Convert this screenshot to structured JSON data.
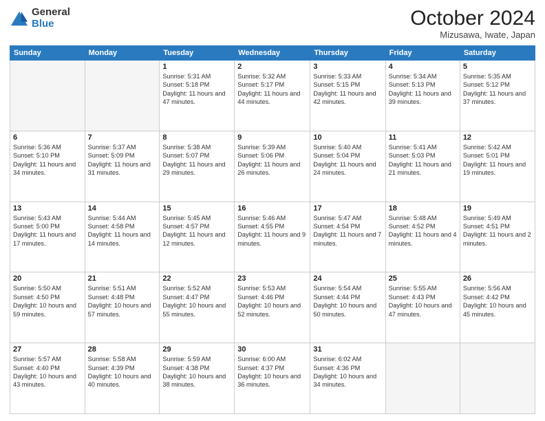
{
  "logo": {
    "general": "General",
    "blue": "Blue"
  },
  "header": {
    "month": "October 2024",
    "location": "Mizusawa, Iwate, Japan"
  },
  "days_of_week": [
    "Sunday",
    "Monday",
    "Tuesday",
    "Wednesday",
    "Thursday",
    "Friday",
    "Saturday"
  ],
  "weeks": [
    [
      {
        "day": "",
        "info": ""
      },
      {
        "day": "",
        "info": ""
      },
      {
        "day": "1",
        "info": "Sunrise: 5:31 AM\nSunset: 5:18 PM\nDaylight: 11 hours and 47 minutes."
      },
      {
        "day": "2",
        "info": "Sunrise: 5:32 AM\nSunset: 5:17 PM\nDaylight: 11 hours and 44 minutes."
      },
      {
        "day": "3",
        "info": "Sunrise: 5:33 AM\nSunset: 5:15 PM\nDaylight: 11 hours and 42 minutes."
      },
      {
        "day": "4",
        "info": "Sunrise: 5:34 AM\nSunset: 5:13 PM\nDaylight: 11 hours and 39 minutes."
      },
      {
        "day": "5",
        "info": "Sunrise: 5:35 AM\nSunset: 5:12 PM\nDaylight: 11 hours and 37 minutes."
      }
    ],
    [
      {
        "day": "6",
        "info": "Sunrise: 5:36 AM\nSunset: 5:10 PM\nDaylight: 11 hours and 34 minutes."
      },
      {
        "day": "7",
        "info": "Sunrise: 5:37 AM\nSunset: 5:09 PM\nDaylight: 11 hours and 31 minutes."
      },
      {
        "day": "8",
        "info": "Sunrise: 5:38 AM\nSunset: 5:07 PM\nDaylight: 11 hours and 29 minutes."
      },
      {
        "day": "9",
        "info": "Sunrise: 5:39 AM\nSunset: 5:06 PM\nDaylight: 11 hours and 26 minutes."
      },
      {
        "day": "10",
        "info": "Sunrise: 5:40 AM\nSunset: 5:04 PM\nDaylight: 11 hours and 24 minutes."
      },
      {
        "day": "11",
        "info": "Sunrise: 5:41 AM\nSunset: 5:03 PM\nDaylight: 11 hours and 21 minutes."
      },
      {
        "day": "12",
        "info": "Sunrise: 5:42 AM\nSunset: 5:01 PM\nDaylight: 11 hours and 19 minutes."
      }
    ],
    [
      {
        "day": "13",
        "info": "Sunrise: 5:43 AM\nSunset: 5:00 PM\nDaylight: 11 hours and 17 minutes."
      },
      {
        "day": "14",
        "info": "Sunrise: 5:44 AM\nSunset: 4:58 PM\nDaylight: 11 hours and 14 minutes."
      },
      {
        "day": "15",
        "info": "Sunrise: 5:45 AM\nSunset: 4:57 PM\nDaylight: 11 hours and 12 minutes."
      },
      {
        "day": "16",
        "info": "Sunrise: 5:46 AM\nSunset: 4:55 PM\nDaylight: 11 hours and 9 minutes."
      },
      {
        "day": "17",
        "info": "Sunrise: 5:47 AM\nSunset: 4:54 PM\nDaylight: 11 hours and 7 minutes."
      },
      {
        "day": "18",
        "info": "Sunrise: 5:48 AM\nSunset: 4:52 PM\nDaylight: 11 hours and 4 minutes."
      },
      {
        "day": "19",
        "info": "Sunrise: 5:49 AM\nSunset: 4:51 PM\nDaylight: 11 hours and 2 minutes."
      }
    ],
    [
      {
        "day": "20",
        "info": "Sunrise: 5:50 AM\nSunset: 4:50 PM\nDaylight: 10 hours and 59 minutes."
      },
      {
        "day": "21",
        "info": "Sunrise: 5:51 AM\nSunset: 4:48 PM\nDaylight: 10 hours and 57 minutes."
      },
      {
        "day": "22",
        "info": "Sunrise: 5:52 AM\nSunset: 4:47 PM\nDaylight: 10 hours and 55 minutes."
      },
      {
        "day": "23",
        "info": "Sunrise: 5:53 AM\nSunset: 4:46 PM\nDaylight: 10 hours and 52 minutes."
      },
      {
        "day": "24",
        "info": "Sunrise: 5:54 AM\nSunset: 4:44 PM\nDaylight: 10 hours and 50 minutes."
      },
      {
        "day": "25",
        "info": "Sunrise: 5:55 AM\nSunset: 4:43 PM\nDaylight: 10 hours and 47 minutes."
      },
      {
        "day": "26",
        "info": "Sunrise: 5:56 AM\nSunset: 4:42 PM\nDaylight: 10 hours and 45 minutes."
      }
    ],
    [
      {
        "day": "27",
        "info": "Sunrise: 5:57 AM\nSunset: 4:40 PM\nDaylight: 10 hours and 43 minutes."
      },
      {
        "day": "28",
        "info": "Sunrise: 5:58 AM\nSunset: 4:39 PM\nDaylight: 10 hours and 40 minutes."
      },
      {
        "day": "29",
        "info": "Sunrise: 5:59 AM\nSunset: 4:38 PM\nDaylight: 10 hours and 38 minutes."
      },
      {
        "day": "30",
        "info": "Sunrise: 6:00 AM\nSunset: 4:37 PM\nDaylight: 10 hours and 36 minutes."
      },
      {
        "day": "31",
        "info": "Sunrise: 6:02 AM\nSunset: 4:36 PM\nDaylight: 10 hours and 34 minutes."
      },
      {
        "day": "",
        "info": ""
      },
      {
        "day": "",
        "info": ""
      }
    ]
  ]
}
